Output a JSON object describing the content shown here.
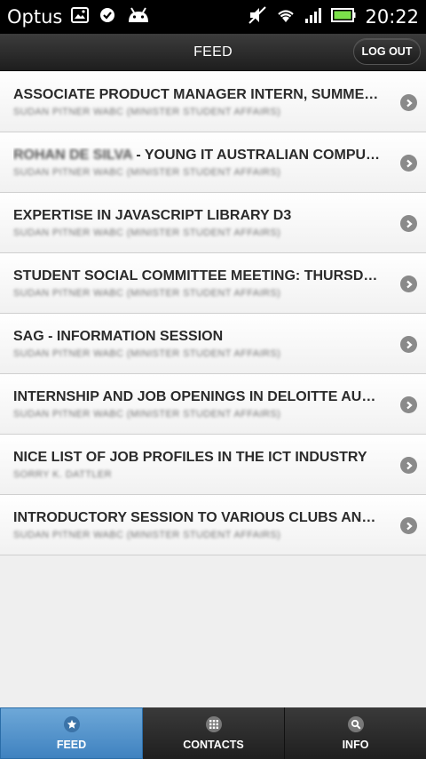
{
  "status_bar": {
    "carrier": "Optus",
    "time": "20:22",
    "battery_color": "#7be04a"
  },
  "header": {
    "title": "FEED",
    "logout_label": "LOG OUT"
  },
  "feed": {
    "items": [
      {
        "title": "ASSOCIATE PRODUCT MANAGER INTERN, SUMMER POSITION",
        "subtitle": "SUDAN PITNER WABC (MINISTER STUDENT AFFAIRS)"
      },
      {
        "title_prefix": "ROHAN DE SILVA",
        "title": " - YOUNG IT AUSTRALIAN COMPUTER SOCIETY",
        "subtitle": "SUDAN PITNER WABC (MINISTER STUDENT AFFAIRS)"
      },
      {
        "title": "EXPERTISE IN JAVASCRIPT LIBRARY D3",
        "subtitle": "SUDAN PITNER WABC (MINISTER STUDENT AFFAIRS)"
      },
      {
        "title": "STUDENT SOCIAL COMMITTEE MEETING: THURSDAY SEPTEMBER",
        "subtitle": "SUDAN PITNER WABC (MINISTER STUDENT AFFAIRS)"
      },
      {
        "title": "SAG - INFORMATION SESSION",
        "subtitle": "SUDAN PITNER WABC (MINISTER STUDENT AFFAIRS)"
      },
      {
        "title": "INTERNSHIP AND JOB OPENINGS IN DELOITTE AUSTRALIA",
        "subtitle": "SUDAN PITNER WABC (MINISTER STUDENT AFFAIRS)"
      },
      {
        "title": "NICE LIST OF JOB PROFILES IN THE ICT INDUSTRY",
        "subtitle": "SORRY K. DATTLER"
      },
      {
        "title": "INTRODUCTORY SESSION TO VARIOUS CLUBS AND THE STUDENTS",
        "subtitle": "SUDAN PITNER WABC (MINISTER STUDENT AFFAIRS)"
      }
    ]
  },
  "tabs": [
    {
      "label": "FEED",
      "icon": "star-icon",
      "active": true
    },
    {
      "label": "CONTACTS",
      "icon": "grid-icon",
      "active": false
    },
    {
      "label": "INFO",
      "icon": "search-icon",
      "active": false
    }
  ],
  "colors": {
    "active_tab": "#4a8ac6",
    "header_bg": "#2a2a2a"
  }
}
